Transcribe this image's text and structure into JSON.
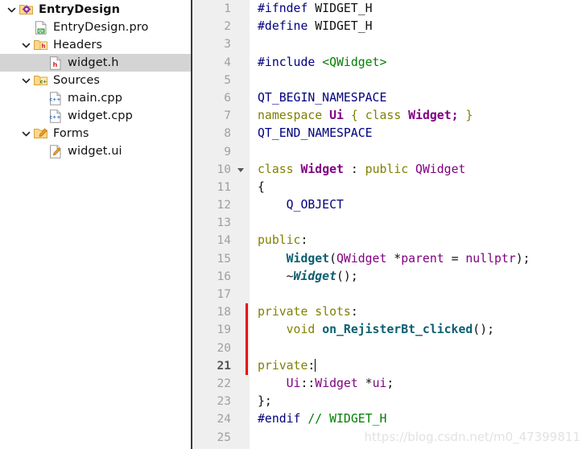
{
  "sidebar": {
    "name": "project-tree",
    "items": [
      {
        "label": "EntryDesign",
        "icon": "project-folder-gear-icon",
        "level": 0,
        "expanded": true,
        "bold": true,
        "selected": false
      },
      {
        "label": "EntryDesign.pro",
        "icon": "qt-pro-file-icon",
        "level": 1,
        "expanded": null,
        "bold": false,
        "selected": false
      },
      {
        "label": "Headers",
        "icon": "headers-folder-icon",
        "level": 1,
        "expanded": true,
        "bold": false,
        "selected": false
      },
      {
        "label": "widget.h",
        "icon": "header-file-icon",
        "level": 2,
        "expanded": null,
        "bold": false,
        "selected": true
      },
      {
        "label": "Sources",
        "icon": "sources-folder-icon",
        "level": 1,
        "expanded": true,
        "bold": false,
        "selected": false
      },
      {
        "label": "main.cpp",
        "icon": "cpp-file-icon",
        "level": 2,
        "expanded": null,
        "bold": false,
        "selected": false
      },
      {
        "label": "widget.cpp",
        "icon": "cpp-file-icon",
        "level": 2,
        "expanded": null,
        "bold": false,
        "selected": false
      },
      {
        "label": "Forms",
        "icon": "forms-folder-icon",
        "level": 1,
        "expanded": true,
        "bold": false,
        "selected": false
      },
      {
        "label": "widget.ui",
        "icon": "ui-file-icon",
        "level": 2,
        "expanded": null,
        "bold": false,
        "selected": false
      }
    ]
  },
  "editor": {
    "name": "code-editor",
    "current_line": 21,
    "change_marker_lines": [
      18,
      19,
      20,
      21
    ],
    "fold_marker_lines": [
      10
    ],
    "line_numbers": [
      "1",
      "2",
      "3",
      "4",
      "5",
      "6",
      "7",
      "8",
      "9",
      "10",
      "11",
      "12",
      "13",
      "14",
      "15",
      "16",
      "17",
      "18",
      "19",
      "20",
      "21",
      "22",
      "23",
      "24",
      "25"
    ],
    "lines": [
      {
        "n": 1,
        "text": "#ifndef WIDGET_H"
      },
      {
        "n": 2,
        "text": "#define WIDGET_H"
      },
      {
        "n": 3,
        "text": ""
      },
      {
        "n": 4,
        "text": "#include <QWidget>"
      },
      {
        "n": 5,
        "text": ""
      },
      {
        "n": 6,
        "text": "QT_BEGIN_NAMESPACE"
      },
      {
        "n": 7,
        "text": "namespace Ui { class Widget; }"
      },
      {
        "n": 8,
        "text": "QT_END_NAMESPACE"
      },
      {
        "n": 9,
        "text": ""
      },
      {
        "n": 10,
        "text": "class Widget : public QWidget"
      },
      {
        "n": 11,
        "text": "{"
      },
      {
        "n": 12,
        "text": "    Q_OBJECT"
      },
      {
        "n": 13,
        "text": ""
      },
      {
        "n": 14,
        "text": "public:"
      },
      {
        "n": 15,
        "text": "    Widget(QWidget *parent = nullptr);"
      },
      {
        "n": 16,
        "text": "    ~Widget();"
      },
      {
        "n": 17,
        "text": ""
      },
      {
        "n": 18,
        "text": "private slots:"
      },
      {
        "n": 19,
        "text": "    void on_RejisterBt_clicked();"
      },
      {
        "n": 20,
        "text": ""
      },
      {
        "n": 21,
        "text": "private:"
      },
      {
        "n": 22,
        "text": "    Ui::Widget *ui;"
      },
      {
        "n": 23,
        "text": "};"
      },
      {
        "n": 24,
        "text": "#endif // WIDGET_H"
      },
      {
        "n": 25,
        "text": ""
      }
    ]
  },
  "watermark": {
    "text": "https://blog.csdn.net/m0_47399811"
  },
  "colors": {
    "preprocessor": "#000080",
    "string": "#008000",
    "comment": "#008000",
    "keyword": "#808000",
    "type": "#800080",
    "function": "#0b5f70",
    "line_number": "#a0a0a0",
    "gutter_bg": "#efefef",
    "selection_bg": "#d4d4d4",
    "change_marker": "#ee0000"
  }
}
